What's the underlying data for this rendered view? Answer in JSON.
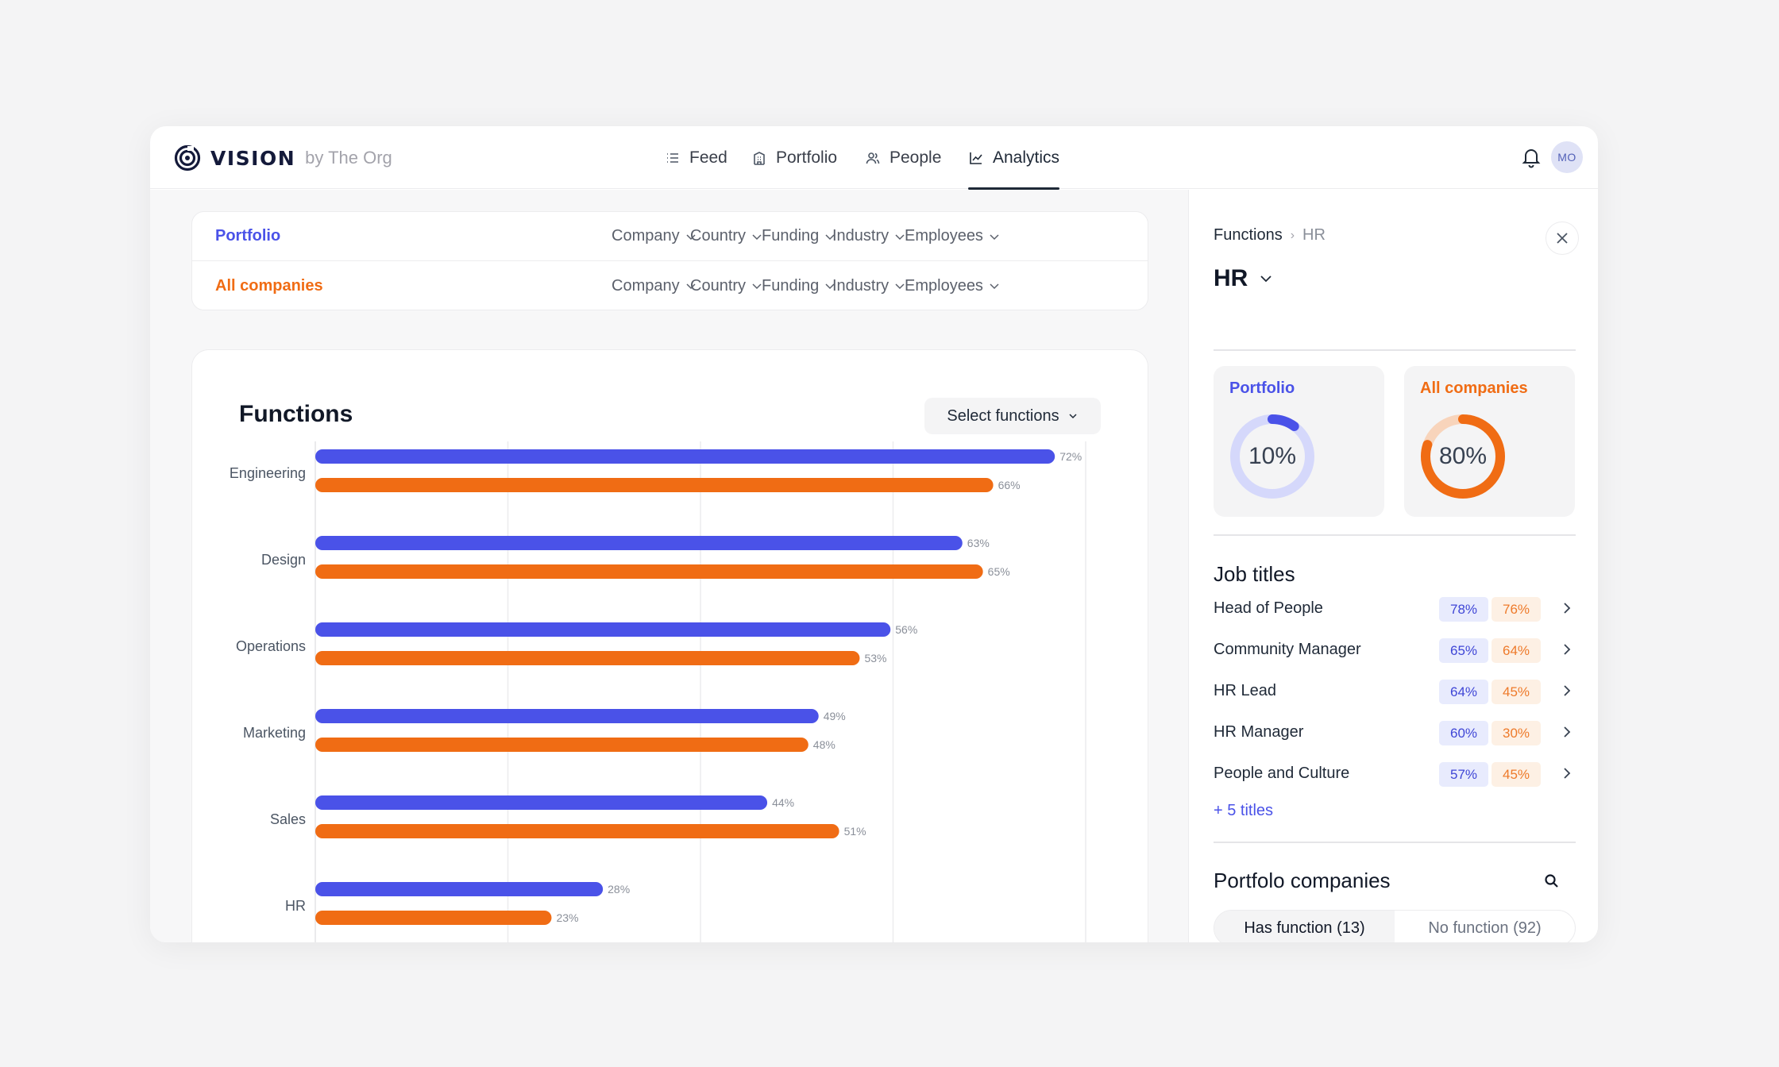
{
  "app": {
    "brand": "VISION",
    "brand_suffix": "by The Org",
    "avatar_initials": "MO"
  },
  "nav": [
    {
      "label": "Feed",
      "icon": "list-icon"
    },
    {
      "label": "Portfolio",
      "icon": "building-icon"
    },
    {
      "label": "People",
      "icon": "people-icon"
    },
    {
      "label": "Analytics",
      "icon": "chart-line-icon",
      "active": true
    }
  ],
  "filters": {
    "rows": [
      {
        "label": "Portfolio",
        "color": "#4a52e8"
      },
      {
        "label": "All companies",
        "color": "#f06c14"
      }
    ],
    "dropdowns": [
      "Company",
      "Country",
      "Funding",
      "Industry",
      "Employees"
    ]
  },
  "functions_card": {
    "title": "Functions",
    "select_label": "Select functions"
  },
  "chart_data": {
    "type": "bar",
    "orientation": "horizontal",
    "categories": [
      "Engineering",
      "Design",
      "Operations",
      "Marketing",
      "Sales",
      "HR"
    ],
    "series": [
      {
        "name": "Portfolio",
        "color": "#4a52e8",
        "values": [
          72,
          63,
          56,
          49,
          44,
          28
        ]
      },
      {
        "name": "All companies",
        "color": "#f06c14",
        "values": [
          66,
          65,
          53,
          48,
          51,
          23
        ]
      }
    ],
    "value_suffix": "%",
    "xlim": [
      0,
      75
    ],
    "gridlines": [
      0,
      18.75,
      37.5,
      56.25,
      75
    ],
    "grid": true
  },
  "panel": {
    "breadcrumb": {
      "parent": "Functions",
      "current": "HR"
    },
    "title": "HR",
    "stats": [
      {
        "label": "Portfolio",
        "value": 10,
        "display": "10%",
        "color": "#4a52e8",
        "track": "#d5d8fb"
      },
      {
        "label": "All companies",
        "value": 80,
        "display": "80%",
        "color": "#f06c14",
        "track": "#f8d4bb"
      }
    ],
    "job_titles_heading": "Job titles",
    "job_titles": [
      {
        "name": "Head of People",
        "portfolio": "78%",
        "all": "76%"
      },
      {
        "name": "Community Manager",
        "portfolio": "65%",
        "all": "64%"
      },
      {
        "name": "HR Lead",
        "portfolio": "64%",
        "all": "45%"
      },
      {
        "name": "HR Manager",
        "portfolio": "60%",
        "all": "30%"
      },
      {
        "name": "People and Culture",
        "portfolio": "57%",
        "all": "45%"
      }
    ],
    "more_titles": "+ 5 titles",
    "companies_heading": "Portfolo companies",
    "tabs": [
      {
        "label": "Has function (13)",
        "active": true
      },
      {
        "label": "No function (92)",
        "active": false
      }
    ]
  }
}
